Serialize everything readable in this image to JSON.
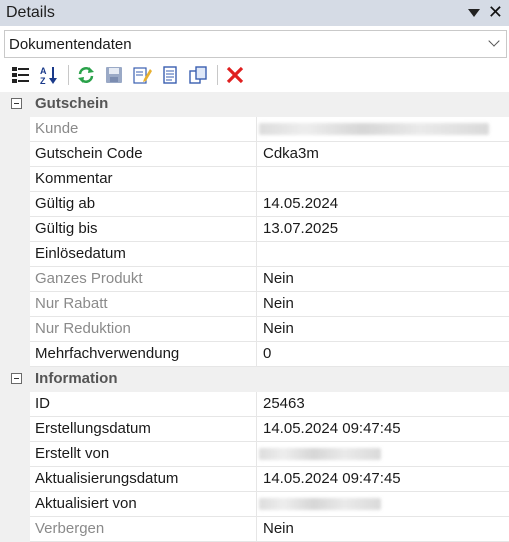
{
  "panel": {
    "title": "Details"
  },
  "dropdown": {
    "selected": "Dokumentendaten"
  },
  "toolbar": {
    "buttons": [
      {
        "icon": "categorized-view-icon"
      },
      {
        "icon": "sort-az-icon"
      },
      {
        "icon": "refresh-icon"
      },
      {
        "icon": "save-icon"
      },
      {
        "icon": "edit-icon"
      },
      {
        "icon": "document-icon"
      },
      {
        "icon": "copy-icon"
      },
      {
        "icon": "delete-icon"
      }
    ],
    "accent": "#e02020"
  },
  "sections": {
    "gutschein": {
      "title": "Gutschein",
      "kunde": {
        "label": "Kunde",
        "value": ""
      },
      "code": {
        "label": "Gutschein Code",
        "value": "Cdka3m"
      },
      "kommentar": {
        "label": "Kommentar",
        "value": ""
      },
      "gueltig_ab": {
        "label": "Gültig ab",
        "value": "14.05.2024"
      },
      "gueltig_bis": {
        "label": "Gültig bis",
        "value": "13.07.2025"
      },
      "einloesedatum": {
        "label": "Einlösedatum",
        "value": ""
      },
      "ganzes_produkt": {
        "label": "Ganzes Produkt",
        "value": "Nein"
      },
      "nur_rabatt": {
        "label": "Nur Rabatt",
        "value": "Nein"
      },
      "nur_reduktion": {
        "label": "Nur Reduktion",
        "value": "Nein"
      },
      "mehrfach": {
        "label": "Mehrfachverwendung",
        "value": "0"
      }
    },
    "information": {
      "title": "Information",
      "id": {
        "label": "ID",
        "value": "25463"
      },
      "erstellungsdatum": {
        "label": "Erstellungsdatum",
        "value": "14.05.2024 09:47:45"
      },
      "erstellt_von": {
        "label": "Erstellt von",
        "value": ""
      },
      "aktualisierungsdatum": {
        "label": "Aktualisierungsdatum",
        "value": "14.05.2024 09:47:45"
      },
      "aktualisiert_von": {
        "label": "Aktualisiert von",
        "value": ""
      },
      "verbergen": {
        "label": "Verbergen",
        "value": "Nein"
      }
    }
  }
}
